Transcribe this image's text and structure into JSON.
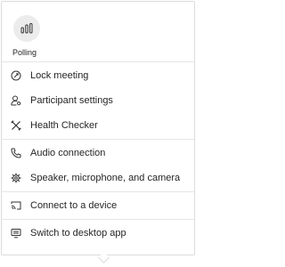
{
  "polling": {
    "label": "Polling",
    "icon": "polling-icon"
  },
  "groups": [
    [
      {
        "label": "Lock meeting",
        "icon": "lock-meeting-icon"
      },
      {
        "label": "Participant settings",
        "icon": "participant-settings-icon"
      },
      {
        "label": "Health Checker",
        "icon": "health-checker-icon"
      }
    ],
    [
      {
        "label": "Audio connection",
        "icon": "phone-icon"
      },
      {
        "label": "Speaker, microphone, and camera",
        "icon": "gear-icon"
      }
    ],
    [
      {
        "label": "Connect to a device",
        "icon": "cast-icon"
      }
    ],
    [
      {
        "label": "Switch to desktop app",
        "icon": "desktop-app-icon"
      }
    ]
  ]
}
